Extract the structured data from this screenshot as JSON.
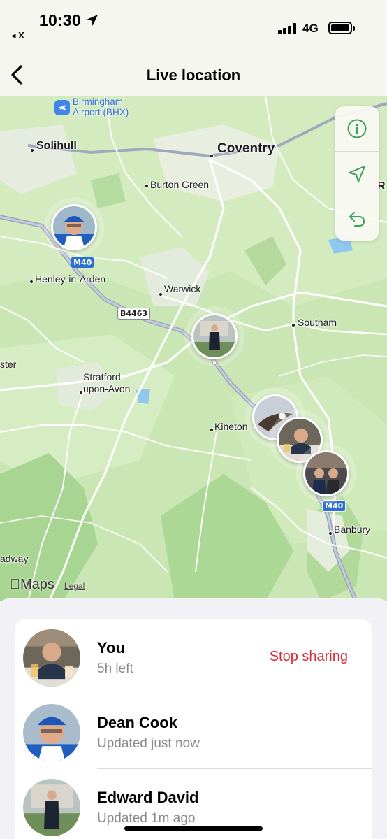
{
  "status_bar": {
    "time": "10:30",
    "back_app": "◂ X",
    "network": "4G",
    "icons": [
      "location-arrow-icon",
      "cellular-signal-icon",
      "battery-icon"
    ]
  },
  "nav": {
    "title": "Live location",
    "back_icon": "chevron-left-icon"
  },
  "map": {
    "airport": "Birmingham\nAirport (BHX)",
    "places": {
      "solihull": "Solihull",
      "coventry": "Coventry",
      "burton_green": "Burton Green",
      "henley": "Henley-in-Arden",
      "warwick": "Warwick",
      "southam": "Southam",
      "stratford": "Stratford-\nupon-Avon",
      "kineton": "Kineton",
      "banbury": "Banbury",
      "ster": "ster",
      "adway": "adway",
      "r_edge": "R"
    },
    "roads": {
      "m40_a": "M40",
      "b4463": "B4463",
      "m40_b": "M40"
    },
    "controls": [
      "info-icon",
      "location-arrow-icon",
      "return-icon"
    ],
    "attribution": {
      "maps_logo": "Maps",
      "legal": "Legal"
    }
  },
  "contacts": [
    {
      "name": "You",
      "status": "5h left",
      "action": "Stop sharing"
    },
    {
      "name": "Dean Cook",
      "status": "Updated just now"
    },
    {
      "name": "Edward David",
      "status": "Updated 1m ago"
    }
  ],
  "colors": {
    "map_green": "#c9e6b4",
    "accent_green": "#3aa05a",
    "destructive_red": "#d32f3f",
    "secondary_text": "#8a8a8e"
  }
}
